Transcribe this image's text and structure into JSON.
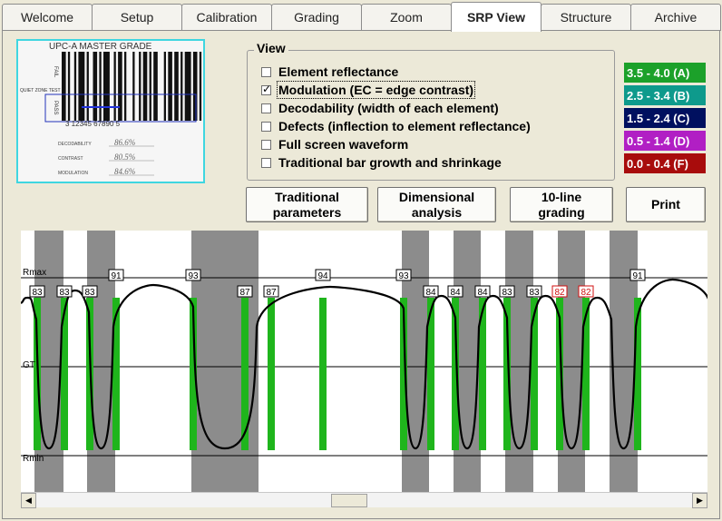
{
  "tabs": [
    {
      "label": "Welcome",
      "active": false
    },
    {
      "label": "Setup",
      "active": false
    },
    {
      "label": "Calibration",
      "active": false
    },
    {
      "label": "Grading",
      "active": false
    },
    {
      "label": "Zoom",
      "active": false
    },
    {
      "label": "SRP View",
      "active": true
    },
    {
      "label": "Structure",
      "active": false
    },
    {
      "label": "Archive",
      "active": false
    }
  ],
  "barcode_image": {
    "header": "UPC-A MASTER GRADE",
    "side_label_left": "QUIET ZONE TEST",
    "vertical_text_top": "FAIL",
    "vertical_text_bottom": "PASS",
    "digits": "3 12345 67890 5",
    "rows": [
      {
        "label": "DECODABILITY",
        "value": "86.6%"
      },
      {
        "label": "CONTRAST",
        "value": "80.5%"
      },
      {
        "label": "MODULATION",
        "value": "84.6%"
      }
    ]
  },
  "view": {
    "title": "View",
    "options": [
      {
        "label": "Element reflectance",
        "checked": false
      },
      {
        "label": "Modulation (EC = edge contrast)",
        "checked": true
      },
      {
        "label": "Decodability (width of each element)",
        "checked": false
      },
      {
        "label": "Defects (inflection to element reflectance)",
        "checked": false
      },
      {
        "label": "Full screen waveform",
        "checked": false
      },
      {
        "label": "Traditional bar growth and shrinkage",
        "checked": false
      }
    ]
  },
  "grades": [
    {
      "label": "3.5 - 4.0 (A)",
      "color": "#1ca12a"
    },
    {
      "label": "2.5 - 3.4 (B)",
      "color": "#0e9a8c"
    },
    {
      "label": "1.5 - 2.4 (C)",
      "color": "#00105f"
    },
    {
      "label": "0.5 - 1.4 (D)",
      "color": "#b11fc4"
    },
    {
      "label": "0.0 - 0.4 (F)",
      "color": "#a80c0c"
    }
  ],
  "buttons": {
    "traditional": "Traditional\nparameters",
    "dimensional": "Dimensional\nanalysis",
    "grading10": "10-line\ngrading",
    "print": "Print"
  },
  "chart": {
    "labels": {
      "rmax": "Rmax",
      "gt": "GT",
      "rmin": "Rmin"
    },
    "edge_contrast": [
      {
        "value": "83",
        "fail": false
      },
      {
        "value": "83",
        "fail": false
      },
      {
        "value": "83",
        "fail": false
      },
      {
        "value": "91",
        "fail": false
      },
      {
        "value": "93",
        "fail": false
      },
      {
        "value": "87",
        "fail": false
      },
      {
        "value": "87",
        "fail": false
      },
      {
        "value": "94",
        "fail": false
      },
      {
        "value": "93",
        "fail": false
      },
      {
        "value": "84",
        "fail": false
      },
      {
        "value": "84",
        "fail": false
      },
      {
        "value": "84",
        "fail": false
      },
      {
        "value": "83",
        "fail": false
      },
      {
        "value": "83",
        "fail": false
      },
      {
        "value": "82",
        "fail": true
      },
      {
        "value": "82",
        "fail": true
      },
      {
        "value": "91",
        "fail": false
      }
    ]
  }
}
